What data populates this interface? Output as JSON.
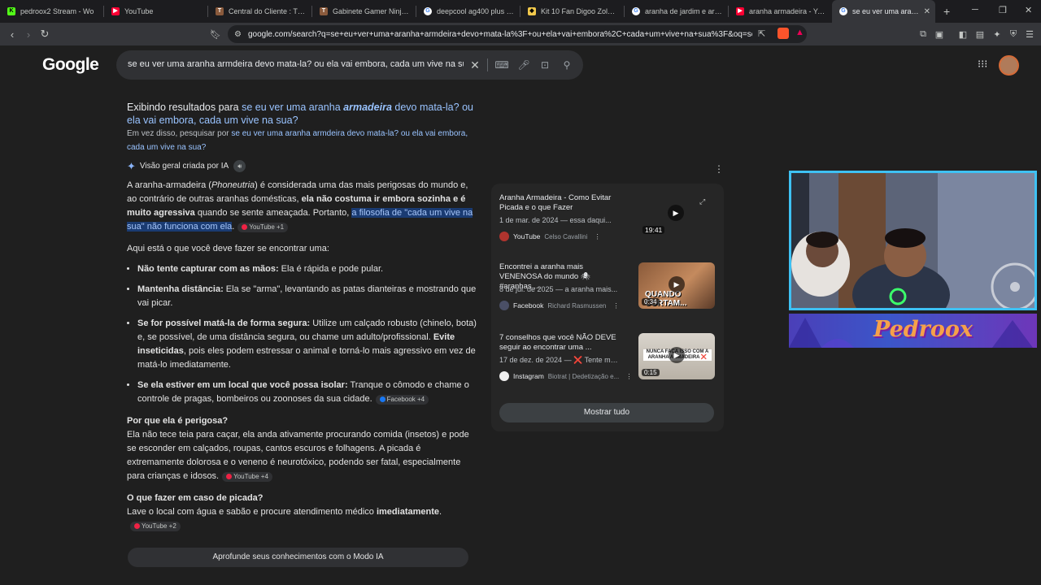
{
  "tabs": [
    {
      "label": "pedroox2 Stream - Wo",
      "icon": "kick-icon",
      "color": "#53fc18"
    },
    {
      "label": "YouTube",
      "icon": "youtube-icon",
      "color": "#ff0033"
    },
    {
      "label": "Central do Cliente : TERAB",
      "icon": "terabyte-icon",
      "color": "#8a5a3c"
    },
    {
      "label": "Gabinete Gamer Ninja Ryo",
      "icon": "terabyte-icon",
      "color": "#8a5a3c"
    },
    {
      "label": "deepcool ag400 plus - Pe",
      "icon": "google-icon",
      "color": "#ffffff"
    },
    {
      "label": "Kit 10 Fan Digoo Zoloe Ar",
      "icon": "store-icon",
      "color": "#f2c94c"
    },
    {
      "label": "aranha de jardim e armad",
      "icon": "google-icon",
      "color": "#ffffff"
    },
    {
      "label": "aranha armadeira - YouTu",
      "icon": "youtube-icon",
      "color": "#ff0033"
    },
    {
      "label": "se eu ver uma aranha",
      "icon": "google-icon",
      "color": "#ffffff",
      "active": true
    }
  ],
  "url": "google.com/search?q=se+eu+ver+uma+aranha+armdeira+devo+mata-la%3F+ou+ela+vai+embora%2C+cada+um+vive+na+sua%3F&oq=se+eu+...",
  "logo": "Google",
  "query": "se eu ver uma aranha armdeira devo mata-la? ou ela vai embora, cada um vive na sua?",
  "showing": {
    "prefix": "Exibindo resultados para ",
    "pre": "se eu ver uma aranha ",
    "bold": "armadeira",
    "post": " devo mata-la? ou ela vai embora, cada um vive na sua?"
  },
  "instead": {
    "prefix": "Em vez disso, pesquisar por ",
    "link": "se eu ver uma aranha armdeira devo mata-la? ou ela vai embora, cada um vive na sua?"
  },
  "ai": {
    "title": "Visão geral criada por IA",
    "p1": {
      "a": "A aranha-armadeira (",
      "b": "Phoneutria",
      "c": ") é considerada uma das mais perigosas do mundo e, ao contrário de outras aranhas domésticas, ",
      "d": "ela não costuma ir embora sozinha e é muito agressiva",
      "e": " quando se sente ameaçada. Portanto, ",
      "hl": "a filosofia de \"cada um vive na sua\" não funciona com ela",
      "f": ".",
      "src": "YouTube +1"
    },
    "intro": "Aqui está o que você deve fazer se encontrar uma:",
    "tips": [
      {
        "b": "Não tente capturar com as mãos:",
        "t": " Ela é rápida e pode pular."
      },
      {
        "b": "Mantenha distância:",
        "t": " Ela se \"arma\", levantando as patas dianteiras e mostrando que vai picar."
      },
      {
        "b": "Se for possível matá-la de forma segura:",
        "t": " Utilize um calçado robusto (chinelo, bota) e, se possível, de uma distância segura, ou chame um adulto/profissional. ",
        "b2": "Evite inseticidas",
        "t2": ", pois eles podem estressar o animal e torná-lo mais agressivo em vez de matá-lo imediatamente."
      },
      {
        "b": "Se ela estiver em um local que você possa isolar:",
        "t": " Tranque o cômodo e chame o controle de pragas, bombeiros ou zoonoses da sua cidade.",
        "src": "Facebook +4"
      }
    ],
    "why_title": "Por que ela é perigosa?",
    "why_text": "Ela não tece teia para caçar, ela anda ativamente procurando comida (insetos) e pode se esconder em calçados, roupas, cantos escuros e folhagens. A picada é extremamente dolorosa e o veneno é neurotóxico, podendo ser fatal, especialmente para crianças e idosos.",
    "why_src": "YouTube +4",
    "bite_title": "O que fazer em caso de picada?",
    "bite_text": "Lave o local com água e sabão e procure atendimento médico ",
    "bite_bold": "imediatamente",
    "bite_end": ".",
    "bite_src": "YouTube +2",
    "deep_button": "Aprofunde seus conhecimentos com o Modo IA"
  },
  "videos": [
    {
      "title": "Aranha Armadeira - Como Evitar Picada e o que Fazer",
      "date": "1 de mar. de 2024 — essa daqui...",
      "source": "YouTube",
      "sub": "Celso Cavallini",
      "duration": "19:41"
    },
    {
      "title": "Encontrei a aranha mais VENENOSA do mundo 🕷 #aranhas ...",
      "date": "8 de jul. de 2025 — a aranha mais...",
      "source": "Facebook",
      "sub": "Richard Rasmussen",
      "duration": "0:34",
      "thumb_text": "QUANDO CORTAM..."
    },
    {
      "title": "7 conselhos que você NÃO DEVE seguir ao encontrar uma ...",
      "date": "17 de dez. de 2024 — ❌ Tente mat...",
      "source": "Instagram",
      "sub": "Biotrat | Dedetização e...",
      "duration": "0:15",
      "thumb_text": "NUNCA FAÇA ISSO COM A ARANHA ARMADEIRA ❌"
    }
  ],
  "show_all": "Mostrar tudo",
  "banner_text": "Pedroox"
}
